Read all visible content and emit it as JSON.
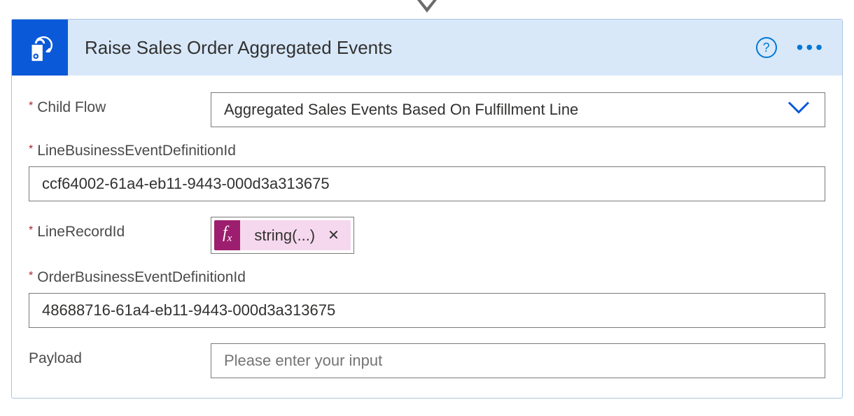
{
  "header": {
    "title": "Raise Sales Order Aggregated Events"
  },
  "fields": {
    "childFlow": {
      "label": "Child Flow",
      "value": "Aggregated Sales Events Based On Fulfillment Line",
      "required": true
    },
    "lineBizEventDefId": {
      "label": "LineBusinessEventDefinitionId",
      "value": "ccf64002-61a4-eb11-9443-000d3a313675",
      "required": true
    },
    "lineRecordId": {
      "label": "LineRecordId",
      "token": "string(...)",
      "required": true
    },
    "orderBizEventDefId": {
      "label": "OrderBusinessEventDefinitionId",
      "value": "48688716-61a4-eb11-9443-000d3a313675",
      "required": true
    },
    "payload": {
      "label": "Payload",
      "placeholder": "Please enter your input",
      "required": false
    }
  }
}
